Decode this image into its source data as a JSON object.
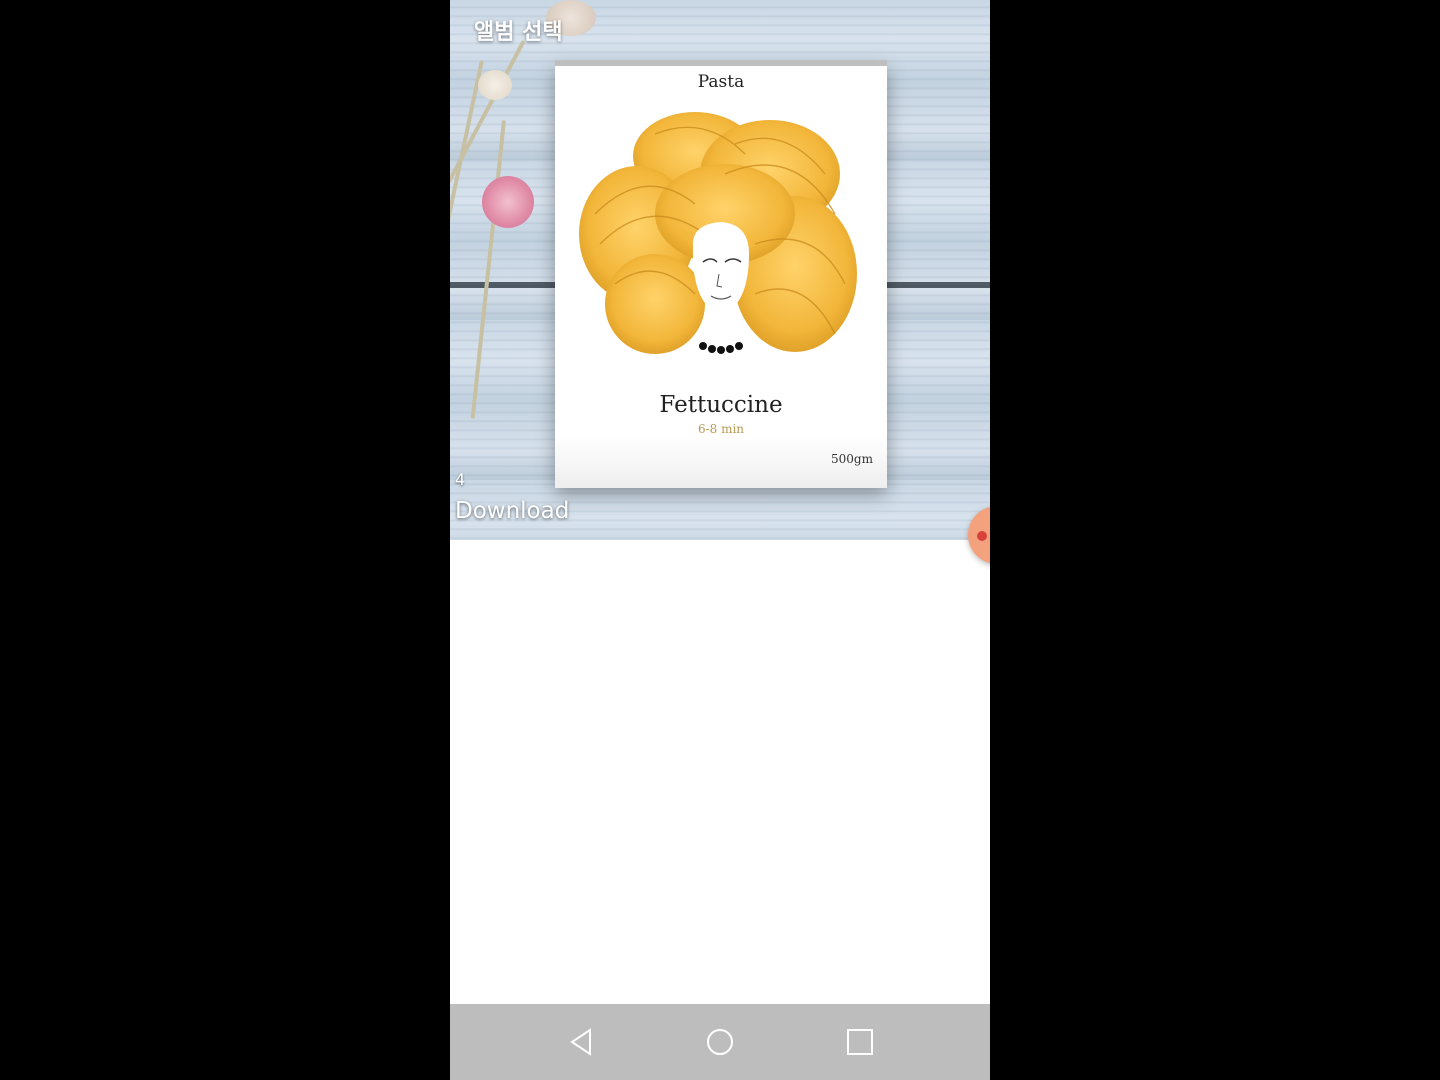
{
  "album": {
    "title": "앨범 선택",
    "count": "4",
    "name": "Download"
  },
  "thumbnail": {
    "brand": "Pasta",
    "product": "Fettuccine",
    "cook_time": "6-8 min",
    "weight": "500gm"
  },
  "navbar": {
    "back_icon": "back-triangle-icon",
    "home_icon": "home-circle-icon",
    "recents_icon": "recents-square-icon"
  },
  "colors": {
    "fab": "#f3a27d",
    "navbar": "#bdbdbd",
    "pasta": "#f2b63a"
  }
}
